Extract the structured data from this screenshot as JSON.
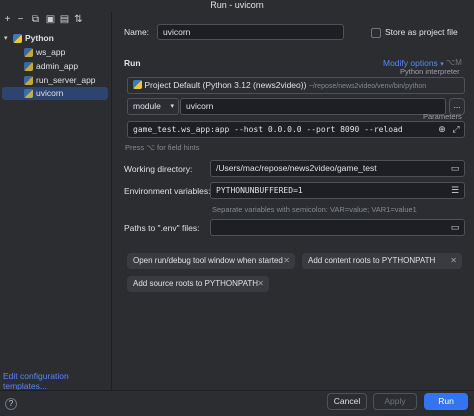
{
  "window": {
    "title": "Run - uvicorn"
  },
  "toolbar": {
    "add": "+",
    "remove": "−",
    "copy": "⧉",
    "save": "▣",
    "folder": "▤",
    "sort": "⇅"
  },
  "tree": {
    "group": {
      "label": "Python"
    },
    "items": [
      {
        "label": "ws_app"
      },
      {
        "label": "admin_app"
      },
      {
        "label": "run_server_app"
      },
      {
        "label": "uvicorn"
      }
    ],
    "edit_templates": "Edit configuration templates..."
  },
  "form": {
    "name_label": "Name:",
    "name_value": "uvicorn",
    "store_label": "Store as project file",
    "run_heading": "Run",
    "modify_options": "Modify options",
    "modify_shortcut": "⌥M",
    "interpreter_caption": "Python interpreter",
    "interpreter_name": "Project Default (Python 3.12 (news2video))",
    "interpreter_path": "~/repose/news2video/venv/bin/python",
    "module_select": "module",
    "module_value": "uvicorn",
    "more": "...",
    "parameters_caption": "Parameters",
    "parameters_value": "game_test.ws_app:app --host 0.0.0.0 --port 8090 --reload",
    "field_hints": "Press ⌥ for field hints",
    "workdir_label": "Working directory:",
    "workdir_value": "/Users/mac/repose/news2video/game_test",
    "env_label": "Environment variables:",
    "env_value": "PYTHONUNBUFFERED=1",
    "env_hint": "Separate variables with semicolon: VAR=value; VAR1=value1",
    "dotenv_label": "Paths to \".env\" files:",
    "chips": [
      {
        "label": "Open run/debug tool window when started"
      },
      {
        "label": "Add content roots to PYTHONPATH"
      },
      {
        "label": "Add source roots to PYTHONPATH"
      }
    ]
  },
  "footer": {
    "help": "?",
    "cancel": "Cancel",
    "apply": "Apply",
    "run": "Run"
  },
  "colors": {
    "background": "#2b2d30",
    "field": "#1e1f22",
    "accent": "#3574f0",
    "link": "#548af7",
    "selection": "#2e436e"
  }
}
